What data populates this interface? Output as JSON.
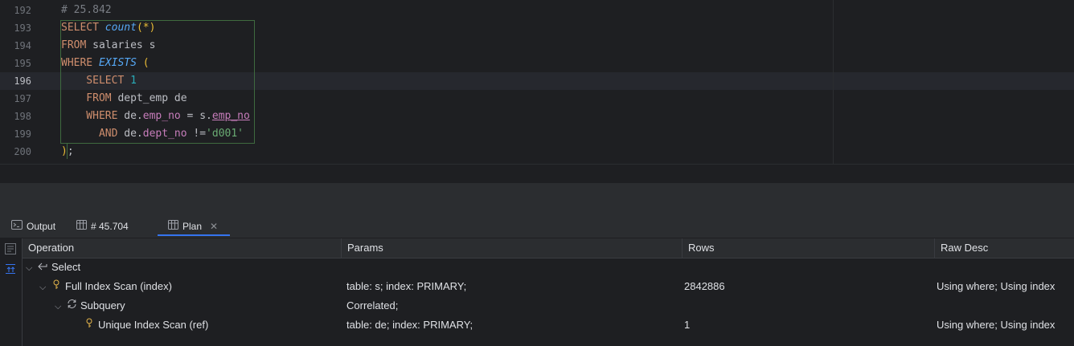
{
  "editor": {
    "line_numbers": [
      "192",
      "193",
      "194",
      "195",
      "196",
      "197",
      "198",
      "199",
      "200"
    ],
    "current_line": "196",
    "lines": [
      [
        {
          "t": "# 25.842",
          "c": "cm"
        }
      ],
      [
        {
          "t": "SELECT ",
          "c": "kw"
        },
        {
          "t": "count",
          "c": "fn"
        },
        {
          "t": "(",
          "c": "par"
        },
        {
          "t": "*",
          "c": "par"
        },
        {
          "t": ")",
          "c": "par"
        }
      ],
      [
        {
          "t": "FROM ",
          "c": "kw"
        },
        {
          "t": "salaries s",
          "c": "id"
        }
      ],
      [
        {
          "t": "WHERE ",
          "c": "kw"
        },
        {
          "t": "EXISTS",
          "c": "fn"
        },
        {
          "t": " (",
          "c": "par"
        }
      ],
      [
        {
          "t": "    SELECT ",
          "c": "kw"
        },
        {
          "t": "1",
          "c": "num"
        }
      ],
      [
        {
          "t": "    FROM ",
          "c": "kw"
        },
        {
          "t": "dept_emp de",
          "c": "id"
        }
      ],
      [
        {
          "t": "    WHERE ",
          "c": "kw"
        },
        {
          "t": "de.",
          "c": "id"
        },
        {
          "t": "emp_no",
          "c": "col2"
        },
        {
          "t": " = s.",
          "c": "id"
        },
        {
          "t": "emp_no",
          "c": "col"
        }
      ],
      [
        {
          "t": "      AND ",
          "c": "kw"
        },
        {
          "t": "de.",
          "c": "id"
        },
        {
          "t": "dept_no",
          "c": "col2"
        },
        {
          "t": " !=",
          "c": "id"
        },
        {
          "t": "'d001'",
          "c": "str"
        }
      ],
      [
        {
          "t": ")",
          "c": "par"
        },
        {
          "t": ";",
          "c": "id"
        }
      ]
    ]
  },
  "tabs": {
    "output": "Output",
    "result": "# 45.704",
    "plan": "Plan",
    "close_icon": "close-icon"
  },
  "plan": {
    "headers": {
      "operation": "Operation",
      "params": "Params",
      "rows": "Rows",
      "raw_desc": "Raw Desc"
    },
    "rows": [
      {
        "operation": "Select",
        "params": "",
        "rows": "",
        "raw_desc": "",
        "icon": "select-arrow-icon",
        "level": 0
      },
      {
        "operation": "Full Index Scan (index)",
        "params": "table: s; index: PRIMARY;",
        "rows": "2842886",
        "raw_desc": "Using where; Using index",
        "icon": "key-icon",
        "level": 1
      },
      {
        "operation": "Subquery",
        "params": "Correlated;",
        "rows": "",
        "raw_desc": "",
        "icon": "refresh-icon",
        "level": 2
      },
      {
        "operation": "Unique Index Scan (ref)",
        "params": "table: de; index: PRIMARY;",
        "rows": "1",
        "raw_desc": "Using where; Using index",
        "icon": "key-icon",
        "level": 3
      }
    ]
  },
  "colors": {
    "accent": "#3574f0",
    "keyword": "#cf8e6d",
    "function": "#56a8f5",
    "string": "#6aab73",
    "number": "#2aacb8",
    "column": "#c77dbb"
  }
}
